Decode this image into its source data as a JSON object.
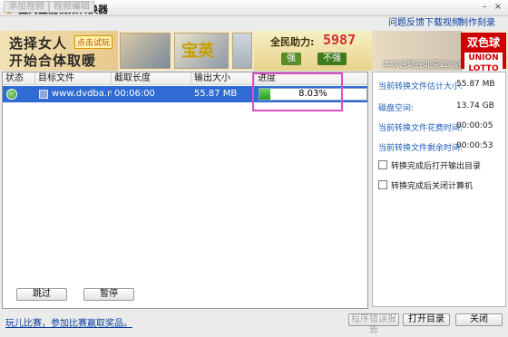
{
  "window": {
    "title": "狸窝全能视频转换器",
    "minimize_glyph": "–",
    "close_glyph": "×"
  },
  "toolbar": {
    "add_video": "添加视频",
    "video_edit": "视频编辑",
    "links": [
      "问题反馈",
      "下载视频",
      "制作刻录DVD"
    ]
  },
  "banner": {
    "slogan_line1": "选择女人",
    "slogan_line2": "开始合体取暖",
    "tag": "点击试玩",
    "char_label": "宝英",
    "mid_title": "全民助力:",
    "mid_number": "5987",
    "pill_left": "强",
    "pill_right": "不强",
    "right_caption": "本次活动在北京20%参与",
    "lotto_title": "双色球",
    "lotto_sub": "UNION LOTTO"
  },
  "table": {
    "columns": [
      "状态",
      "目标文件",
      "截取长度",
      "输出大小",
      "进度"
    ],
    "rows": [
      {
        "file": "www.dvdba.net....",
        "length": "00:06:00",
        "size": "55.87 MB",
        "progress_label": "8.03%",
        "progress": 0.0803
      }
    ]
  },
  "footer_buttons": {
    "skip": "跳过",
    "pause": "暂停"
  },
  "info": {
    "items": [
      {
        "label": "当前转换文件估计大小:",
        "value": "55.87 MB"
      },
      {
        "label": "磁盘空间:",
        "value": "13.74 GB"
      },
      {
        "label": "当前转换文件花费时间:",
        "value": "00:00:05"
      },
      {
        "label": "当前转换文件剩余时间:",
        "value": "00:00:53"
      }
    ],
    "options": [
      {
        "label": "转换完成后打开输出目录",
        "checked": false
      },
      {
        "label": "转换完成后关闭计算机",
        "checked": false
      }
    ]
  },
  "bottom": {
    "contest_link": "玩儿比赛，参加比赛赢取奖品。",
    "report_error": "程序错误报告",
    "open_dir": "打开目录",
    "close": "关闭"
  },
  "colors": {
    "selected_row": "#2f6bd3",
    "progress_fill": "#249a1d",
    "highlight_box": "#e04cc7",
    "link": "#0b3f9c"
  }
}
